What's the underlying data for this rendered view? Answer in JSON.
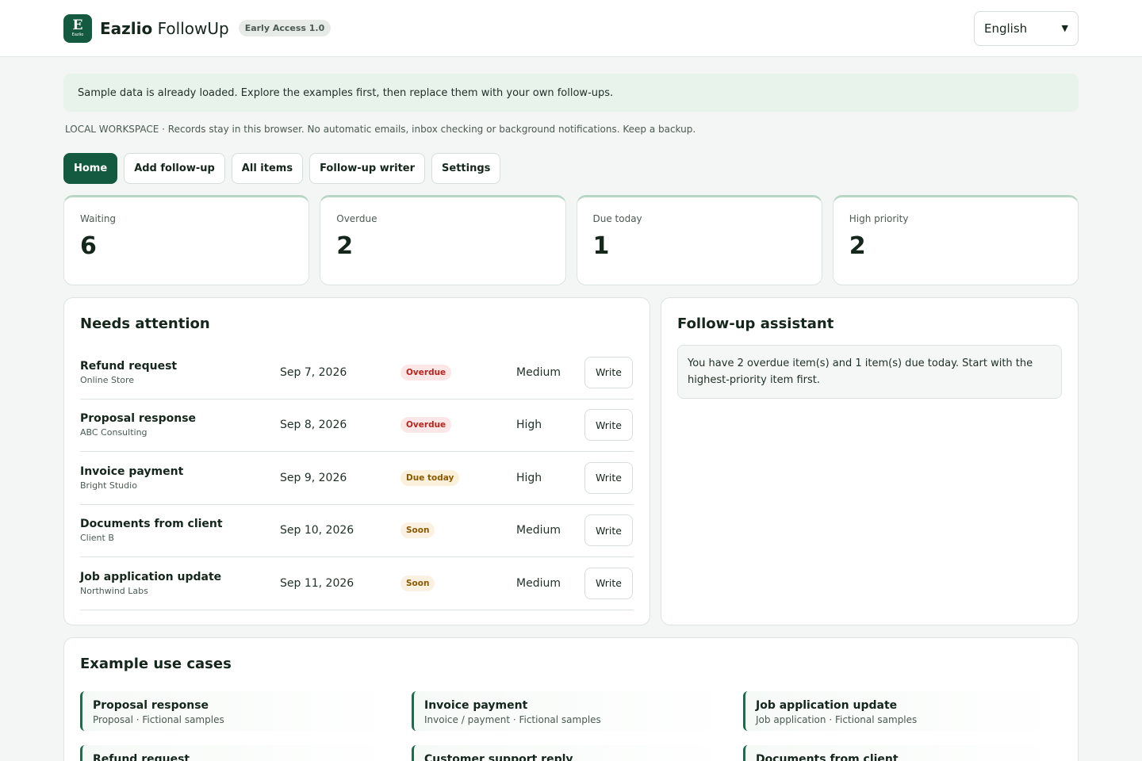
{
  "header": {
    "logo_letter": "E",
    "logo_small": "Eazlio",
    "brand_bold": "Eazlio",
    "brand_rest": "FollowUp",
    "badge": "Early Access 1.0",
    "language": "English"
  },
  "notice": "Sample data is already loaded. Explore the examples first, then replace them with your own follow-ups.",
  "workspace_note": "LOCAL WORKSPACE · Records stay in this browser. No automatic emails, inbox checking or background notifications. Keep a backup.",
  "tabs": [
    {
      "label": "Home",
      "active": true
    },
    {
      "label": "Add follow-up",
      "active": false
    },
    {
      "label": "All items",
      "active": false
    },
    {
      "label": "Follow-up writer",
      "active": false
    },
    {
      "label": "Settings",
      "active": false
    }
  ],
  "stats": [
    {
      "label": "Waiting",
      "value": "6"
    },
    {
      "label": "Overdue",
      "value": "2"
    },
    {
      "label": "Due today",
      "value": "1"
    },
    {
      "label": "High priority",
      "value": "2"
    }
  ],
  "attention": {
    "title": "Needs attention",
    "write_label": "Write",
    "items": [
      {
        "title": "Refund request",
        "sub": "Online Store",
        "date": "Sep 7, 2026",
        "status": "Overdue",
        "status_kind": "overdue",
        "priority": "Medium"
      },
      {
        "title": "Proposal response",
        "sub": "ABC Consulting",
        "date": "Sep 8, 2026",
        "status": "Overdue",
        "status_kind": "overdue",
        "priority": "High"
      },
      {
        "title": "Invoice payment",
        "sub": "Bright Studio",
        "date": "Sep 9, 2026",
        "status": "Due today",
        "status_kind": "today",
        "priority": "High"
      },
      {
        "title": "Documents from client",
        "sub": "Client B",
        "date": "Sep 10, 2026",
        "status": "Soon",
        "status_kind": "soon",
        "priority": "Medium"
      },
      {
        "title": "Job application update",
        "sub": "Northwind Labs",
        "date": "Sep 11, 2026",
        "status": "Soon",
        "status_kind": "soon",
        "priority": "Medium"
      }
    ]
  },
  "assistant": {
    "title": "Follow-up assistant",
    "message": "You have 2 overdue item(s) and 1 item(s) due today. Start with the highest-priority item first."
  },
  "examples": {
    "title": "Example use cases",
    "items": [
      {
        "title": "Proposal response",
        "sub": "Proposal · Fictional samples"
      },
      {
        "title": "Invoice payment",
        "sub": "Invoice / payment · Fictional samples"
      },
      {
        "title": "Job application update",
        "sub": "Job application · Fictional samples"
      },
      {
        "title": "Refund request",
        "sub": ""
      },
      {
        "title": "Customer support reply",
        "sub": ""
      },
      {
        "title": "Documents from client",
        "sub": ""
      }
    ]
  },
  "colors": {
    "brand": "#145a41",
    "overdue": "#b3261e",
    "due_today": "#8a5a00",
    "notice_bg": "#e8f3ec"
  }
}
